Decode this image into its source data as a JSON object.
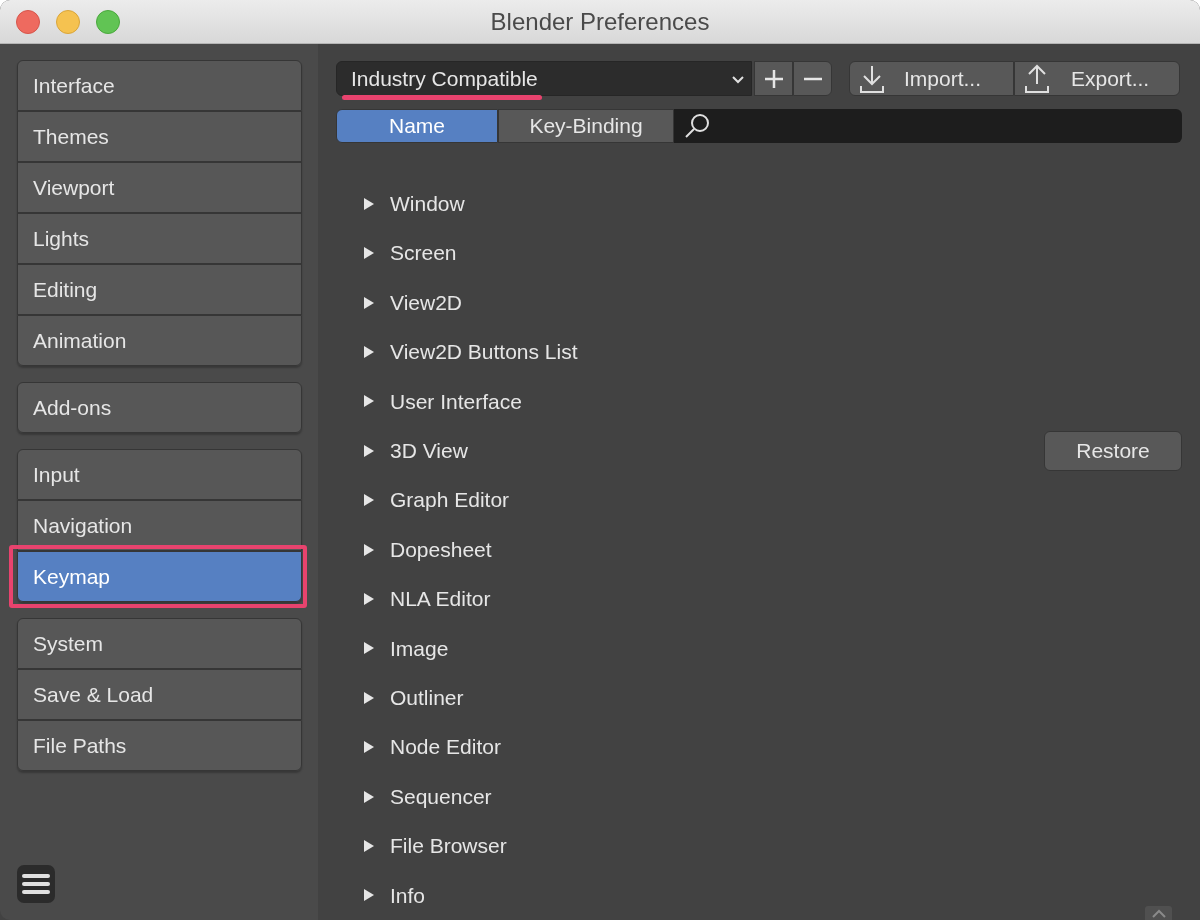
{
  "window": {
    "title": "Blender Preferences"
  },
  "sidebar": {
    "groups": [
      {
        "items": [
          {
            "label": "Interface",
            "selected": false,
            "highlighted": false
          },
          {
            "label": "Themes",
            "selected": false,
            "highlighted": false
          },
          {
            "label": "Viewport",
            "selected": false,
            "highlighted": false
          },
          {
            "label": "Lights",
            "selected": false,
            "highlighted": false
          },
          {
            "label": "Editing",
            "selected": false,
            "highlighted": false
          },
          {
            "label": "Animation",
            "selected": false,
            "highlighted": false
          }
        ]
      },
      {
        "items": [
          {
            "label": "Add-ons",
            "selected": false,
            "highlighted": false
          }
        ]
      },
      {
        "items": [
          {
            "label": "Input",
            "selected": false,
            "highlighted": false
          },
          {
            "label": "Navigation",
            "selected": false,
            "highlighted": false
          },
          {
            "label": "Keymap",
            "selected": true,
            "highlighted": true
          }
        ]
      },
      {
        "items": [
          {
            "label": "System",
            "selected": false,
            "highlighted": false
          },
          {
            "label": "Save & Load",
            "selected": false,
            "highlighted": false
          },
          {
            "label": "File Paths",
            "selected": false,
            "highlighted": false
          }
        ]
      }
    ]
  },
  "keymap_preset": {
    "value": "Industry Compatible",
    "underlined": true
  },
  "toolbar": {
    "import": "Import...",
    "export": "Export..."
  },
  "filter_tabs": [
    {
      "label": "Name",
      "selected": true
    },
    {
      "label": "Key-Binding",
      "selected": false
    }
  ],
  "keymap_list": [
    {
      "label": "Window",
      "expanded": false
    },
    {
      "label": "Screen",
      "expanded": false
    },
    {
      "label": "View2D",
      "expanded": false
    },
    {
      "label": "View2D Buttons List",
      "expanded": false
    },
    {
      "label": "User Interface",
      "expanded": false
    },
    {
      "label": "3D View",
      "expanded": false,
      "button": "Restore"
    },
    {
      "label": "Graph Editor",
      "expanded": false
    },
    {
      "label": "Dopesheet",
      "expanded": false
    },
    {
      "label": "NLA Editor",
      "expanded": false
    },
    {
      "label": "Image",
      "expanded": false
    },
    {
      "label": "Outliner",
      "expanded": false
    },
    {
      "label": "Node Editor",
      "expanded": false
    },
    {
      "label": "Sequencer",
      "expanded": false
    },
    {
      "label": "File Browser",
      "expanded": false
    },
    {
      "label": "Info",
      "expanded": false
    }
  ]
}
